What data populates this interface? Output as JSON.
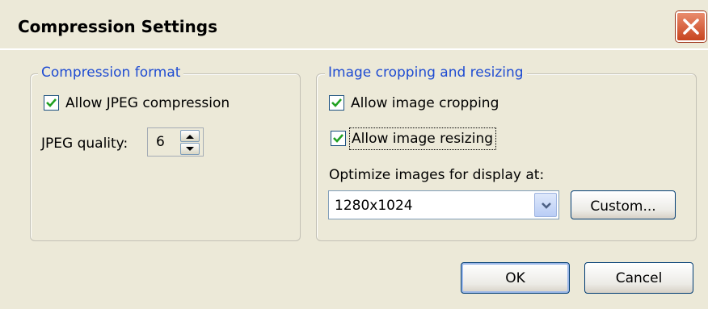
{
  "dialog": {
    "title": "Compression Settings"
  },
  "compression_format": {
    "legend": "Compression format",
    "allow_jpeg": {
      "label": "Allow JPEG compression",
      "checked": true
    },
    "quality": {
      "label": "JPEG quality:",
      "value": "6"
    }
  },
  "image_cropping": {
    "legend": "Image cropping and resizing",
    "allow_cropping": {
      "label": "Allow image cropping",
      "checked": true
    },
    "allow_resizing": {
      "label": "Allow image resizing",
      "checked": true
    },
    "optimize_label": "Optimize images for display at:",
    "resolution": {
      "selected": "1280x1024"
    },
    "custom_label": "Custom..."
  },
  "buttons": {
    "ok": "OK",
    "cancel": "Cancel"
  },
  "colors": {
    "dialog_bg": "#ece9d8",
    "legend_text": "#1f4cd2",
    "check_mark": "#21a121",
    "close_button": "#c8441f"
  },
  "icons": {
    "close": "close-icon",
    "check": "checkmark-icon",
    "spin_up": "arrow-up-icon",
    "spin_down": "arrow-down-icon",
    "dropdown": "chevron-down-icon"
  }
}
